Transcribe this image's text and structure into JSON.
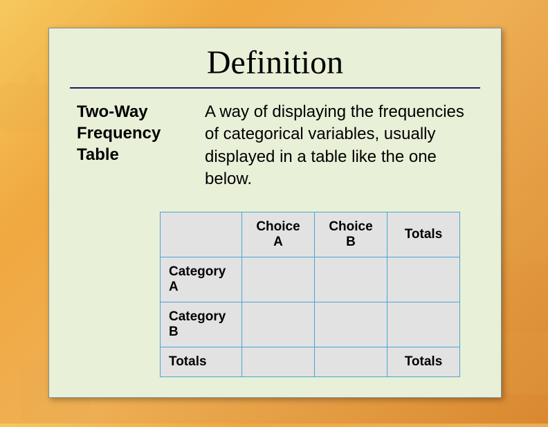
{
  "title": "Definition",
  "term": "Two-Way Frequency Table",
  "description": "A way of displaying the frequencies of categorical variables, usually displayed in a table like the one below.",
  "table": {
    "headers": [
      "",
      "Choice A",
      "Choice B",
      "Totals"
    ],
    "rows": [
      {
        "label": "Category A",
        "cells": [
          "",
          "",
          ""
        ]
      },
      {
        "label": "Category B",
        "cells": [
          "",
          "",
          ""
        ]
      },
      {
        "label": "Totals",
        "cells": [
          "",
          "",
          "Totals"
        ]
      }
    ]
  }
}
